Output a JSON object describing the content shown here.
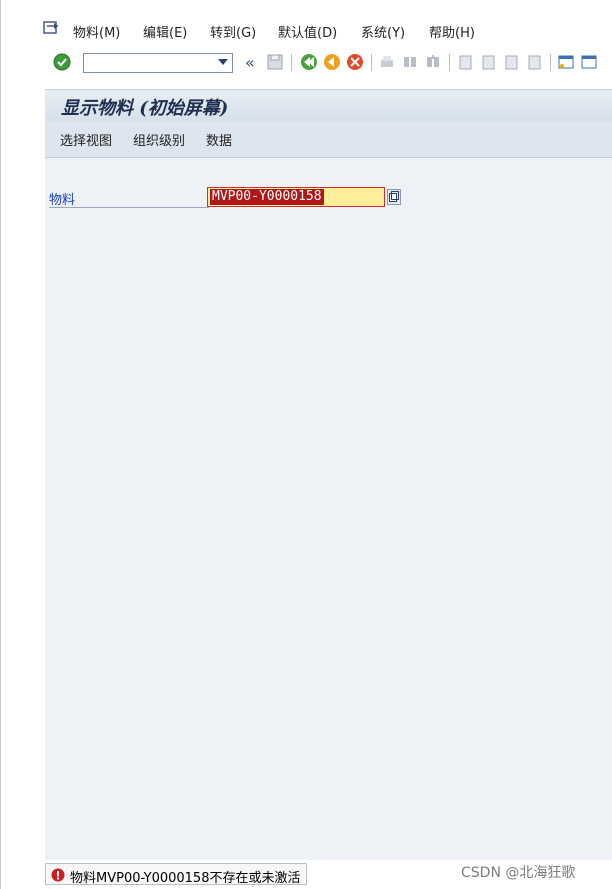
{
  "menu": {
    "items": [
      {
        "label": "物料(M)",
        "underline_char": "M"
      },
      {
        "label": "编辑(E)",
        "underline_char": "E"
      },
      {
        "label": "转到(G)",
        "underline_char": "G"
      },
      {
        "label": "默认值(D)",
        "underline_char": "D"
      },
      {
        "label": "系统(Y)",
        "underline_char": "Y"
      },
      {
        "label": "帮助(H)",
        "underline_char": "H"
      }
    ]
  },
  "toolbar": {
    "command_field_value": "",
    "icons": [
      "enter-icon",
      "command-field-dropdown",
      "collapse-icon",
      "save-icon",
      "back-icon",
      "exit-icon",
      "cancel-icon",
      "print-icon",
      "find-icon",
      "find-next-icon",
      "first-page-icon",
      "previous-page-icon",
      "next-page-icon",
      "last-page-icon",
      "create-session-icon",
      "shortcut-icon"
    ],
    "collapse_glyph": "«"
  },
  "screen": {
    "title": "显示物料 (初始屏幕)"
  },
  "app_toolbar": {
    "buttons": [
      "选择视图",
      "组织级别",
      "数据"
    ]
  },
  "form": {
    "material_label": "物料",
    "material_value": "MVP00-Y0000158"
  },
  "status": {
    "type": "error",
    "message": "物料MVP00-Y0000158不存在或未激活"
  },
  "watermark": "CSDN @北海狂歌",
  "colors": {
    "error": "#cc1f1f",
    "label_blue": "#1a3fbf",
    "field_highlight": "#ffee99",
    "selection": "#b01818"
  }
}
